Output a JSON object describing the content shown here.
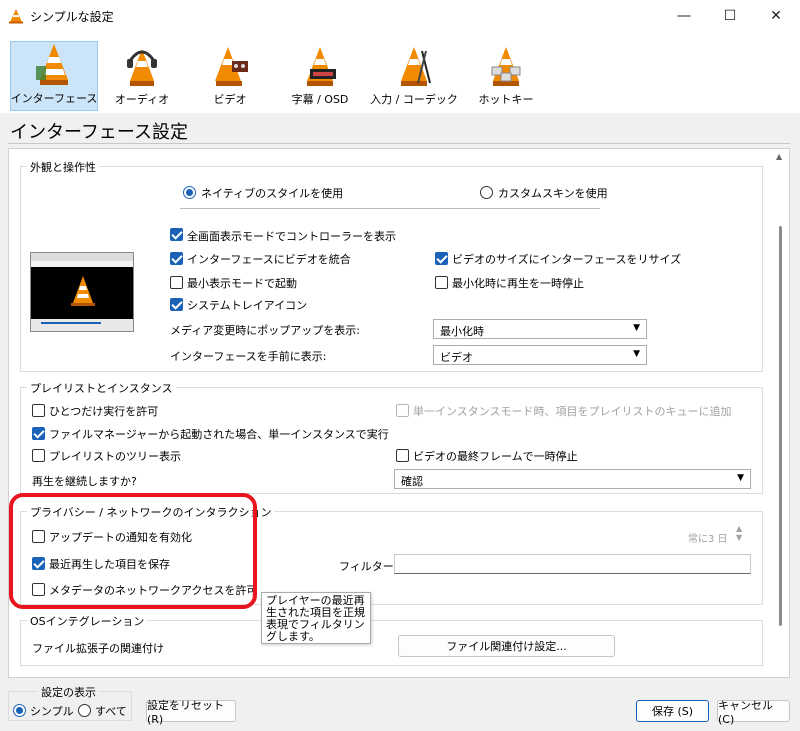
{
  "window": {
    "title": "シンプルな設定",
    "controls": {
      "minimize": "—",
      "maximize": "☐",
      "close": "✕"
    }
  },
  "categories": [
    {
      "label": "インターフェース",
      "icon": "vlc-cone-interface-icon",
      "selected": true
    },
    {
      "label": "オーディオ",
      "icon": "vlc-cone-headphones-icon",
      "selected": false
    },
    {
      "label": "ビデオ",
      "icon": "vlc-cone-video-icon",
      "selected": false
    },
    {
      "label": "字幕 / OSD",
      "icon": "vlc-cone-subtitles-icon",
      "selected": false
    },
    {
      "label": "入力 / コーデック",
      "icon": "vlc-cone-input-icon",
      "selected": false
    },
    {
      "label": "ホットキー",
      "icon": "vlc-cone-hotkeys-icon",
      "selected": false
    }
  ],
  "page_title": "インターフェース設定",
  "appearance": {
    "title": "外観と操作性",
    "radio_native": "ネイティブのスタイルを使用",
    "radio_custom": "カスタムスキンを使用",
    "cb_fullscreen_controller": "全画面表示モードでコントローラーを表示",
    "cb_embed_video": "インターフェースにビデオを統合",
    "cb_resize_interface": "ビデオのサイズにインターフェースをリサイズ",
    "cb_start_minimal": "最小表示モードで起動",
    "cb_pause_minimized": "最小化時に再生を一時停止",
    "cb_systray": "システムトレイアイコン",
    "popup_label": "メディア変更時にポップアップを表示:",
    "popup_value": "最小化時",
    "ontop_label": "インターフェースを手前に表示:",
    "ontop_value": "ビデオ"
  },
  "playlist": {
    "title": "プレイリストとインスタンス",
    "cb_one_instance": "ひとつだけ実行を許可",
    "cb_enqueue": "単一インスタンスモード時、項目をプレイリストのキューに追加",
    "cb_file_manager": "ファイルマネージャーから起動された場合、単一インスタンスで実行",
    "cb_tree": "プレイリストのツリー表示",
    "cb_pause_last_frame": "ビデオの最終フレームで一時停止",
    "resume_label": "再生を継続しますか?",
    "resume_value": "確認"
  },
  "privacy": {
    "title": "プライバシー / ネットワークのインタラクション",
    "cb_update_notify": "アップデートの通知を有効化",
    "update_interval": "常に3 日",
    "cb_save_recent": "最近再生した項目を保存",
    "filter_label": "フィルター:",
    "filter_value": "",
    "cb_metadata_net": "メタデータのネットワークアクセスを許可"
  },
  "tooltip": "プレイヤーの最近再生された項目を正規表現でフィルタリングします。",
  "os_integration": {
    "title": "OSインテグレーション",
    "assoc_label": "ファイル拡張子の関連付け",
    "assoc_button": "ファイル関連付け設定..."
  },
  "footer": {
    "show_settings_title": "設定の表示",
    "radio_simple": "シンプル",
    "radio_all": "すべて",
    "reset_button": "設定をリセット (R)",
    "save_button": "保存 (S)",
    "cancel_button": "キャンセル (C)"
  },
  "colors": {
    "accent": "#1a62b8",
    "highlight_box": "#e8151f",
    "selected_tab": "#cce4f7",
    "cone_orange": "#f08a00"
  }
}
